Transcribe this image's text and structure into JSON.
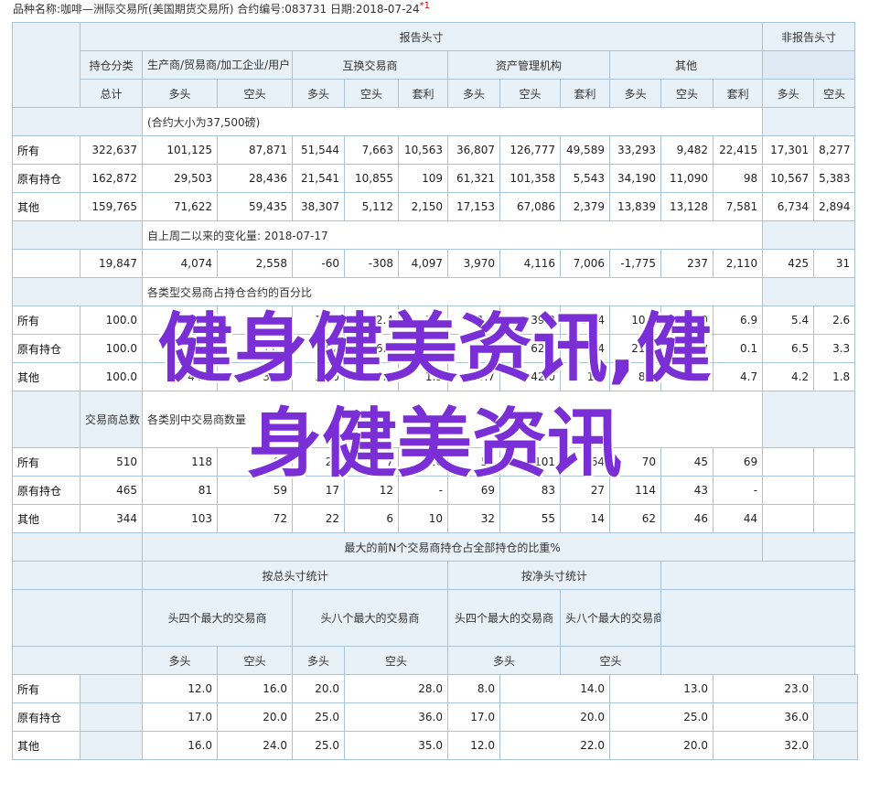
{
  "header": {
    "text": "品种名称:咖啡—洲际交易所(美国期货交易所)   合约编号:083731   日期:2018-07-24",
    "mark": "*1"
  },
  "labels": {
    "report_positions": "报告头寸",
    "nonreport_positions": "非报告头寸",
    "position_class": "持仓分类",
    "producer": "生产商/贸易商/加工企业/用户",
    "swap": "互换交易商",
    "managed_money": "资产管理机构",
    "other": "其他",
    "total": "总计",
    "long": "多头",
    "short": "空头",
    "spread": "套利",
    "all": "所有",
    "old": "原有持仓",
    "other_row": "其他",
    "trader_total": "交易商总数",
    "top4": "头四个最大的交易商",
    "top8": "头八个最大的交易商",
    "gross_stats": "按总头寸统计",
    "net_stats": "按净头寸统计",
    "largest_pct": "最大的前N个交易商持仓占全部持仓的比重%"
  },
  "notes": {
    "contract_size": "(合约大小为37,500磅)",
    "change": "自上周二以来的变化量: 2018-07-17",
    "pct": "各类型交易商占持仓合约的百分比",
    "count": "各类别中交易商数量"
  },
  "rows": {
    "all": [
      "322,637",
      "101,125",
      "87,871",
      "51,544",
      "7,663",
      "10,563",
      "36,807",
      "126,777",
      "49,589",
      "33,293",
      "9,482",
      "22,415",
      "17,301",
      "8,277"
    ],
    "old": [
      "162,872",
      "29,503",
      "28,436",
      "21,541",
      "10,855",
      "109",
      "61,321",
      "101,358",
      "5,543",
      "34,190",
      "11,090",
      "98",
      "10,567",
      "5,383"
    ],
    "other": [
      "159,765",
      "71,622",
      "59,435",
      "38,307",
      "5,112",
      "2,150",
      "17,153",
      "67,086",
      "2,379",
      "13,839",
      "13,128",
      "7,581",
      "6,734",
      "2,894"
    ],
    "change": [
      "19,847",
      "4,074",
      "2,558",
      "-60",
      "-308",
      "4,097",
      "3,970",
      "4,116",
      "7,006",
      "-1,775",
      "237",
      "2,110",
      "425",
      "31"
    ],
    "pct_all": [
      "100.0",
      "31.3",
      "27.2",
      "16.0",
      "2.4",
      "3.3",
      "11.4",
      "39.3",
      "15.4",
      "10.3",
      "2.9",
      "6.9",
      "5.4",
      "2.6"
    ],
    "pct_old": [
      "100.0",
      "18.1",
      "17.5",
      "13.2",
      "6.7",
      "0.1",
      "37.6",
      "62.2",
      "3.4",
      "21.0",
      "6.8",
      "0.1",
      "6.5",
      "3.3"
    ],
    "pct_other": [
      "100.0",
      "44.8",
      "37.2",
      "24.0",
      "3.2",
      "1.3",
      "10.7",
      "42.0",
      "1.5",
      "8.7",
      "8.2",
      "4.7",
      "4.2",
      "1.8"
    ],
    "cnt_all": [
      "510",
      "118",
      "90",
      "24",
      "7",
      "16",
      "57",
      "101",
      "64",
      "70",
      "45",
      "69",
      "",
      ""
    ],
    "cnt_old": [
      "465",
      "81",
      "59",
      "17",
      "12",
      "-",
      "69",
      "83",
      "27",
      "114",
      "43",
      "-",
      "",
      ""
    ],
    "cnt_other": [
      "344",
      "103",
      "72",
      "22",
      "6",
      "10",
      "32",
      "55",
      "14",
      "62",
      "46",
      "44",
      "",
      ""
    ],
    "conc_all": [
      "12.0",
      "16.0",
      "20.0",
      "28.0",
      "8.0",
      "14.0",
      "13.0",
      "23.0"
    ],
    "conc_old": [
      "17.0",
      "20.0",
      "25.0",
      "36.0",
      "17.0",
      "20.0",
      "25.0",
      "36.0"
    ],
    "conc_other": [
      "16.0",
      "24.0",
      "25.0",
      "35.0",
      "12.0",
      "22.0",
      "20.0",
      "32.0"
    ]
  },
  "watermark": {
    "line1": "健身健美资讯,健",
    "line2": "身健美资讯",
    "color": "#7a2ed6"
  }
}
